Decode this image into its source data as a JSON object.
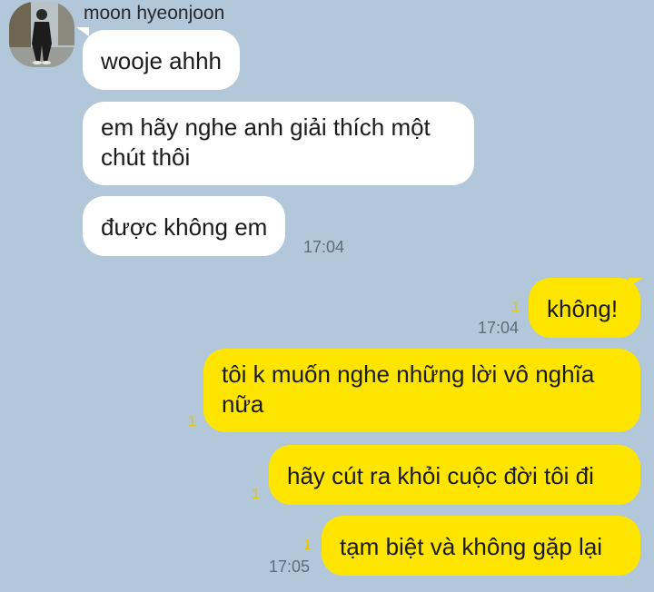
{
  "sender": {
    "name": "moon hyeonjoon"
  },
  "messages": [
    {
      "direction": "incoming",
      "text": "wooje ahhh"
    },
    {
      "direction": "incoming",
      "text": "em hãy nghe anh giải thích một\nchút  thôi"
    },
    {
      "direction": "incoming",
      "text": "được không em",
      "time": "17:04"
    },
    {
      "direction": "outgoing",
      "text": "không!",
      "time": "17:04",
      "unread": "1"
    },
    {
      "direction": "outgoing",
      "text": "tôi k muốn nghe những lời vô nghĩa\nnữa",
      "unread": "1"
    },
    {
      "direction": "outgoing",
      "text": "hãy cút ra khỏi cuộc đời tôi đi",
      "unread": "1"
    },
    {
      "direction": "outgoing",
      "text": "tạm biệt và không gặp lại",
      "time": "17:05",
      "unread": "1"
    }
  ],
  "colors": {
    "background": "#b2c7d9",
    "incoming_bubble": "#ffffff",
    "outgoing_bubble": "#fee500",
    "unread_count": "#e8c600"
  }
}
